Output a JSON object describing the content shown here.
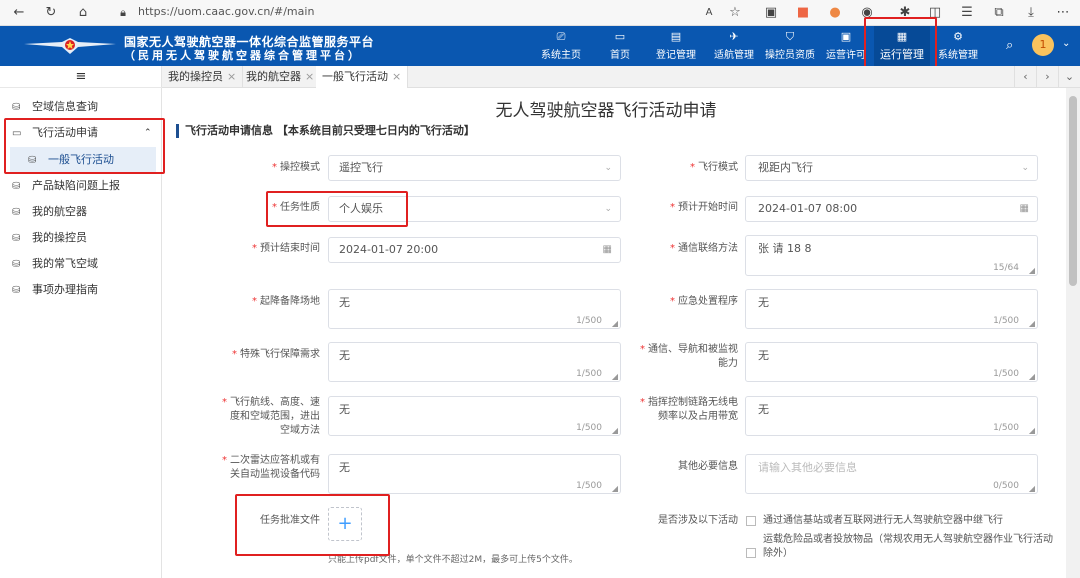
{
  "browser": {
    "url": "https://uom.caac.gov.cn/#/main"
  },
  "header": {
    "title_line1": "国家无人驾驶航空器一体化综合监管服务平台",
    "title_line2": "（民用无人驾驶航空器综合管理平台）",
    "nav": [
      {
        "label": "系统主页",
        "icon": "home-screen-icon"
      },
      {
        "label": "首页",
        "icon": "monitor-icon"
      },
      {
        "label": "登记管理",
        "icon": "document-icon"
      },
      {
        "label": "适航管理",
        "icon": "drone-icon"
      },
      {
        "label": "操控员资质",
        "icon": "shield-icon"
      },
      {
        "label": "运营许可",
        "icon": "license-icon"
      },
      {
        "label": "运行管理",
        "icon": "clipboard-icon"
      },
      {
        "label": "系统管理",
        "icon": "gear-icon"
      }
    ],
    "avatar_text": "1"
  },
  "sidebar": {
    "items": [
      {
        "label": "空域信息查询"
      },
      {
        "label": "飞行活动申请"
      },
      {
        "label": "一般飞行活动"
      },
      {
        "label": "产品缺陷问题上报"
      },
      {
        "label": "我的航空器"
      },
      {
        "label": "我的操控员"
      },
      {
        "label": "我的常飞空域"
      },
      {
        "label": "事项办理指南"
      }
    ]
  },
  "tabs": [
    {
      "label": "我的操控员"
    },
    {
      "label": "我的航空器"
    },
    {
      "label": "一般飞行活动"
    }
  ],
  "main": {
    "title": "无人驾驶航空器飞行活动申请",
    "section": "飞行活动申请信息 【本系统目前只受理七日内的飞行活动】",
    "fields": {
      "control_mode": {
        "label": "操控模式",
        "value": "遥控飞行"
      },
      "flight_mode": {
        "label": "飞行模式",
        "value": "视距内飞行"
      },
      "task_nature": {
        "label": "任务性质",
        "value": "个人娱乐"
      },
      "start_time": {
        "label": "预计开始时间",
        "value": "2024-01-07 08:00"
      },
      "end_time": {
        "label": "预计结束时间",
        "value": "2024-01-07 20:00"
      },
      "contact": {
        "label": "通信联络方法",
        "value": "张    请      18              8",
        "count": "15/64"
      },
      "alt_airport": {
        "label": "起降备降场地",
        "value": "无",
        "count": "1/500"
      },
      "emergency": {
        "label": "应急处置程序",
        "value": "无",
        "count": "1/500"
      },
      "special_support": {
        "label": "特殊飞行保障需求",
        "value": "无",
        "count": "1/500"
      },
      "cns": {
        "label_a": "通信、导航和被监视",
        "label_b": "能力",
        "value": "无",
        "count": "1/500"
      },
      "route": {
        "label_a": "飞行航线、高度、速",
        "label_b": "度和空域范围，进出",
        "label_c": "空域方法",
        "value": "无",
        "count": "1/500"
      },
      "link": {
        "label_a": "指挥控制链路无线电",
        "label_b": "频率以及占用带宽",
        "value": "无",
        "count": "1/500"
      },
      "transponder": {
        "label_a": "二次雷达应答机或有",
        "label_b": "关自动监视设备代码",
        "value": "无",
        "count": "1/500"
      },
      "other": {
        "label": "其他必要信息",
        "placeholder": "请输入其他必要信息",
        "count": "0/500"
      },
      "approval_doc": {
        "label": "任务批准文件",
        "hint": "只能上传pdf文件，单个文件不超过2M，最多可上传5个文件。"
      },
      "involves": {
        "label": "是否涉及以下活动",
        "options": [
          "通过通信基站或者互联网进行无人驾驶航空器中继飞行",
          "运载危险品或者投放物品（常规农用无人驾驶航空器作业飞行活动",
          "除外）"
        ]
      }
    }
  },
  "colors": {
    "header_bg": "#0a57b0",
    "highlight_red": "#e02020",
    "accent": "#1d4f91"
  }
}
